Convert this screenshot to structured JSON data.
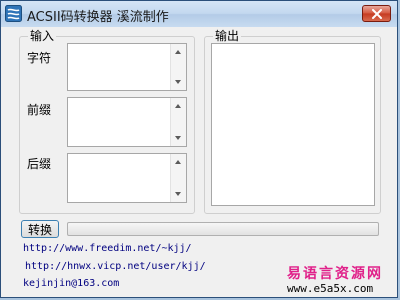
{
  "window": {
    "title": "ACSII码转换器 溪流制作",
    "icon": "app-icon",
    "close_icon": "close-icon"
  },
  "input_group": {
    "title": "输入",
    "fields": [
      {
        "label": "字符",
        "value": ""
      },
      {
        "label": "前缀",
        "value": ""
      },
      {
        "label": "后缀",
        "value": ""
      }
    ]
  },
  "output_group": {
    "title": "输出",
    "value": ""
  },
  "convert_button": {
    "label": "转换"
  },
  "progress": {
    "value": 0
  },
  "links": [
    "http://www.freedim.net/~kjj/",
    "http://hnwx.vicp.net/user/kjj/",
    "kejinjin@163.com"
  ],
  "watermark": {
    "line1": "易语言资源网",
    "line2": "www.e5a5x.com",
    "color": "#e0218a"
  },
  "colors": {
    "title_bar": "#c3d8ef",
    "close_button": "#c53a20",
    "button_border": "#3c7fb1",
    "link": "#000080"
  }
}
